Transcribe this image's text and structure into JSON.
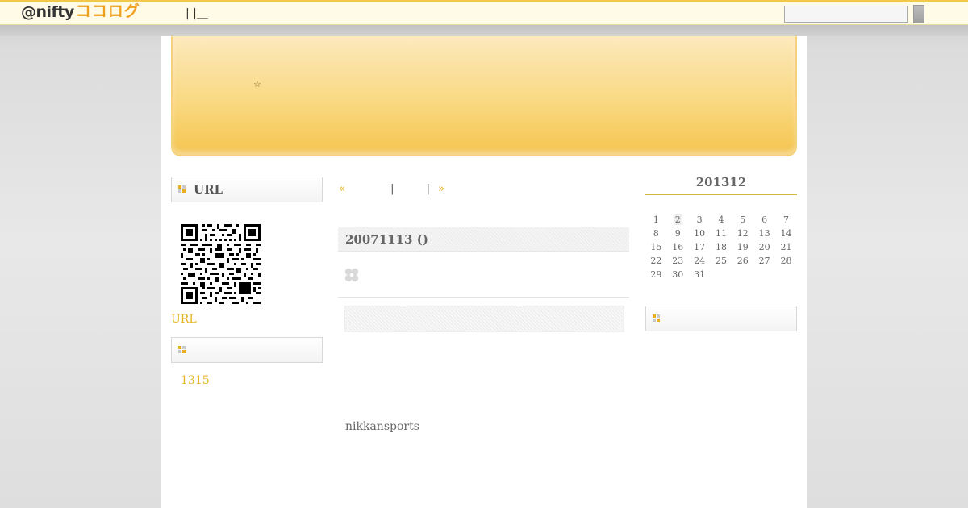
{
  "header": {
    "logo_main": "@nifty",
    "logo_sub": "ココログ",
    "top_links": "| |＿",
    "search_placeholder": ""
  },
  "banner": {
    "star": "☆"
  },
  "left": {
    "url_heading": "URL",
    "url_link": "URL",
    "count_link": "1315"
  },
  "center": {
    "pager_prev": "«",
    "pager_sep1": "|",
    "pager_sep2": "|",
    "pager_next": "»",
    "entry_title": "20071113 ()",
    "source": "nikkansports"
  },
  "calendar": {
    "title": "201312",
    "weeks": [
      [
        "1",
        "2",
        "3",
        "4",
        "5",
        "6",
        "7"
      ],
      [
        "8",
        "9",
        "10",
        "11",
        "12",
        "13",
        "14"
      ],
      [
        "15",
        "16",
        "17",
        "18",
        "19",
        "20",
        "21"
      ],
      [
        "22",
        "23",
        "24",
        "25",
        "26",
        "27",
        "28"
      ],
      [
        "29",
        "30",
        "31",
        "",
        "",
        "",
        ""
      ]
    ],
    "highlighted": [
      "2"
    ]
  },
  "colors": {
    "accent": "#e5b422",
    "banner": "#f6c95a",
    "topbar_border": "#f3c84a"
  }
}
